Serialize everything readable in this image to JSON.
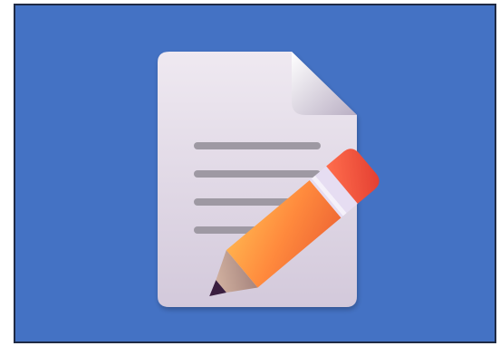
{
  "app": {
    "icon_name": "document-edit-icon",
    "background_color": "#4472C4",
    "border_color": "#1F2A44"
  },
  "document": {
    "icon_name": "document-icon",
    "paper_color": "#E8E1EC",
    "line_color": "#9E99A3",
    "text_lines": 4
  },
  "pencil": {
    "icon_name": "pencil-icon",
    "body_color": "#FF8A3D",
    "eraser_color": "#F2553D",
    "ferrule_color": "#E6DDF2",
    "tip_color": "#3A1E3F"
  }
}
